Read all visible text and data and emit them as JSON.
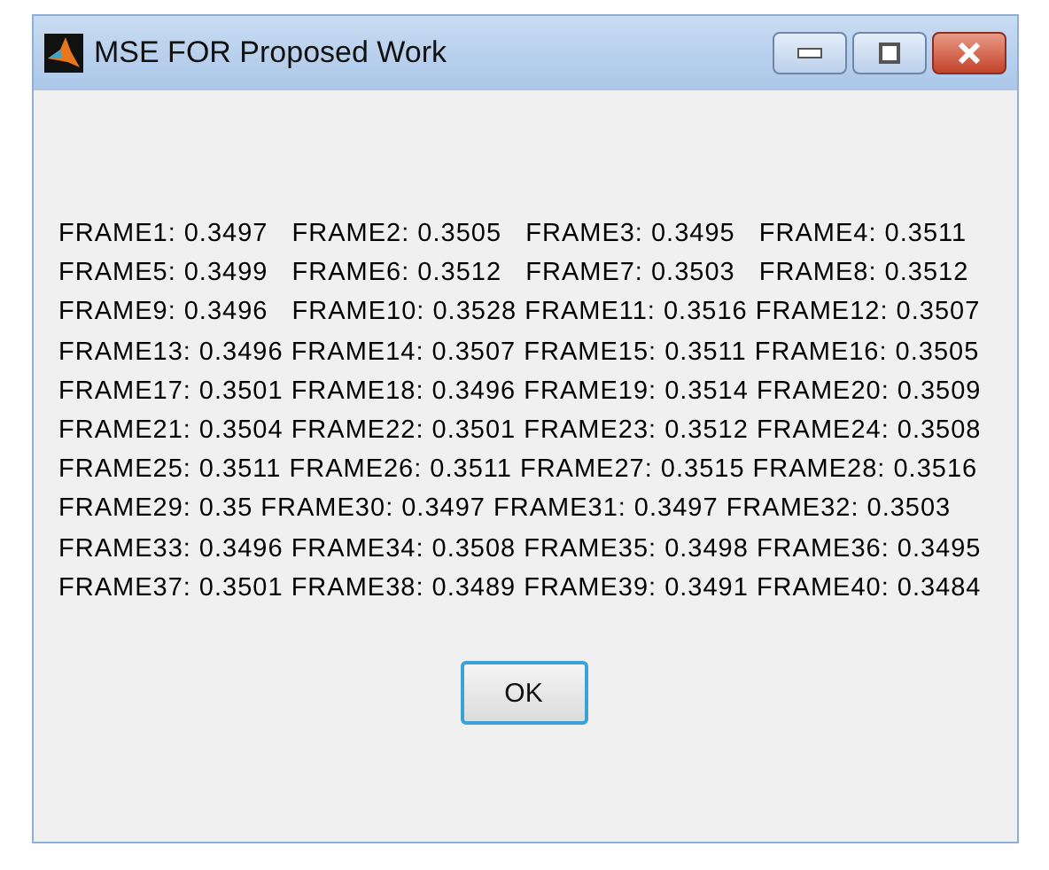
{
  "window": {
    "title": "MSE FOR Proposed Work"
  },
  "message_lines": [
    "FRAME1: 0.3497   FRAME2: 0.3505   FRAME3: 0.3495   FRAME4: 0.3511",
    "FRAME5: 0.3499   FRAME6: 0.3512   FRAME7: 0.3503   FRAME8: 0.3512",
    "FRAME9: 0.3496   FRAME10: 0.3528 FRAME11: 0.3516 FRAME12: 0.3507",
    "FRAME13: 0.3496 FRAME14: 0.3507 FRAME15: 0.3511 FRAME16: 0.3505",
    "FRAME17: 0.3501 FRAME18: 0.3496 FRAME19: 0.3514 FRAME20: 0.3509",
    "FRAME21: 0.3504 FRAME22: 0.3501 FRAME23: 0.3512 FRAME24: 0.3508",
    "FRAME25: 0.3511 FRAME26: 0.3511 FRAME27: 0.3515 FRAME28: 0.3516",
    "FRAME29: 0.35 FRAME30: 0.3497 FRAME31: 0.3497 FRAME32: 0.3503",
    "FRAME33: 0.3496 FRAME34: 0.3508 FRAME35: 0.3498 FRAME36: 0.3495",
    "FRAME37: 0.3501 FRAME38: 0.3489 FRAME39: 0.3491 FRAME40: 0.3484"
  ],
  "buttons": [
    {
      "label": "OK"
    }
  ]
}
